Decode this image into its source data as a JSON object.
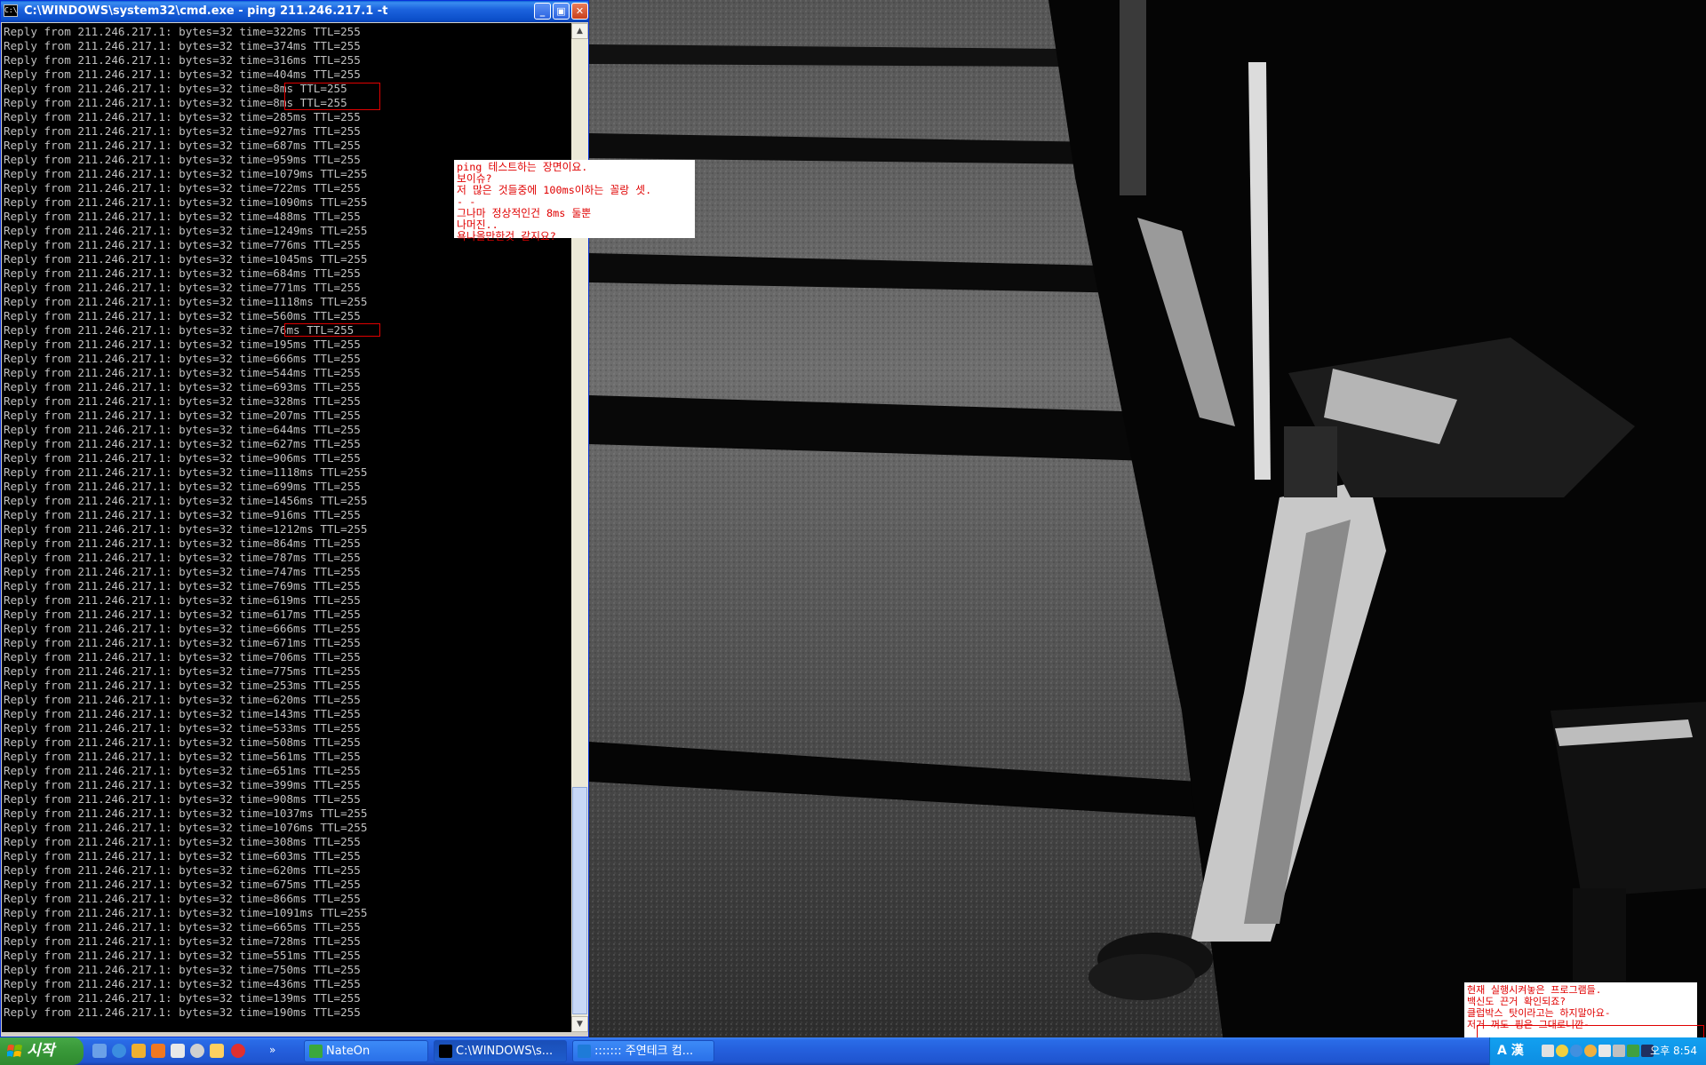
{
  "window": {
    "title": "C:\\WINDOWS\\system32\\cmd.exe - ping 211.246.217.1 -t",
    "icon_label": "C:\\",
    "minimize_glyph": "_",
    "maximize_glyph": "▣",
    "close_glyph": "✕"
  },
  "console": {
    "prefix": "Reply from 211.246.217.1: bytes=32 time=",
    "ttl": "TTL=255",
    "times": [
      "322ms",
      "374ms",
      "316ms",
      "404ms",
      "8ms",
      "8ms",
      "285ms",
      "927ms",
      "687ms",
      "959ms",
      "1079ms",
      "722ms",
      "1090ms",
      "488ms",
      "1249ms",
      "776ms",
      "1045ms",
      "684ms",
      "771ms",
      "1118ms",
      "560ms",
      "76ms",
      "195ms",
      "666ms",
      "544ms",
      "693ms",
      "328ms",
      "207ms",
      "644ms",
      "627ms",
      "906ms",
      "1118ms",
      "699ms",
      "1456ms",
      "916ms",
      "1212ms",
      "864ms",
      "787ms",
      "747ms",
      "769ms",
      "619ms",
      "617ms",
      "666ms",
      "671ms",
      "706ms",
      "775ms",
      "253ms",
      "620ms",
      "143ms",
      "533ms",
      "508ms",
      "561ms",
      "651ms",
      "399ms",
      "908ms",
      "1037ms",
      "1076ms",
      "308ms",
      "603ms",
      "620ms",
      "675ms",
      "866ms",
      "1091ms",
      "665ms",
      "728ms",
      "551ms",
      "750ms",
      "436ms",
      "139ms",
      "190ms"
    ]
  },
  "annotations": {
    "ping_note": "ping 테스트하는 장면이요.\n보이슈?\n저 많은 것들중에 100ms이하는 꼴랑 셋.\n- -\n그나마 정상적인건 8ms 둘뿐\n나머진..\n욕나올만한것 같지요?",
    "tray_note": "현재 실행시켜놓은 프로그램들.\n백신도 끈거 확인되죠?\n클럽박스 탓이라고는 하지말아요-\n저거 꺼도 핑은 그대로니깐-"
  },
  "taskbar": {
    "start_label": "시작",
    "tasks": [
      {
        "label": "NateOn",
        "color": "#3ba83b",
        "active": false
      },
      {
        "label": "C:\\WINDOWS\\s...",
        "color": "#000000",
        "active": true
      },
      {
        "label": "::::::: 주연테크 컴...",
        "color": "#1e7bd8",
        "active": false
      }
    ],
    "ime": "A 漢",
    "clock": "오후 8:54"
  },
  "colors": {
    "annotation": "#e00000",
    "console_text": "#c0c0c0"
  }
}
